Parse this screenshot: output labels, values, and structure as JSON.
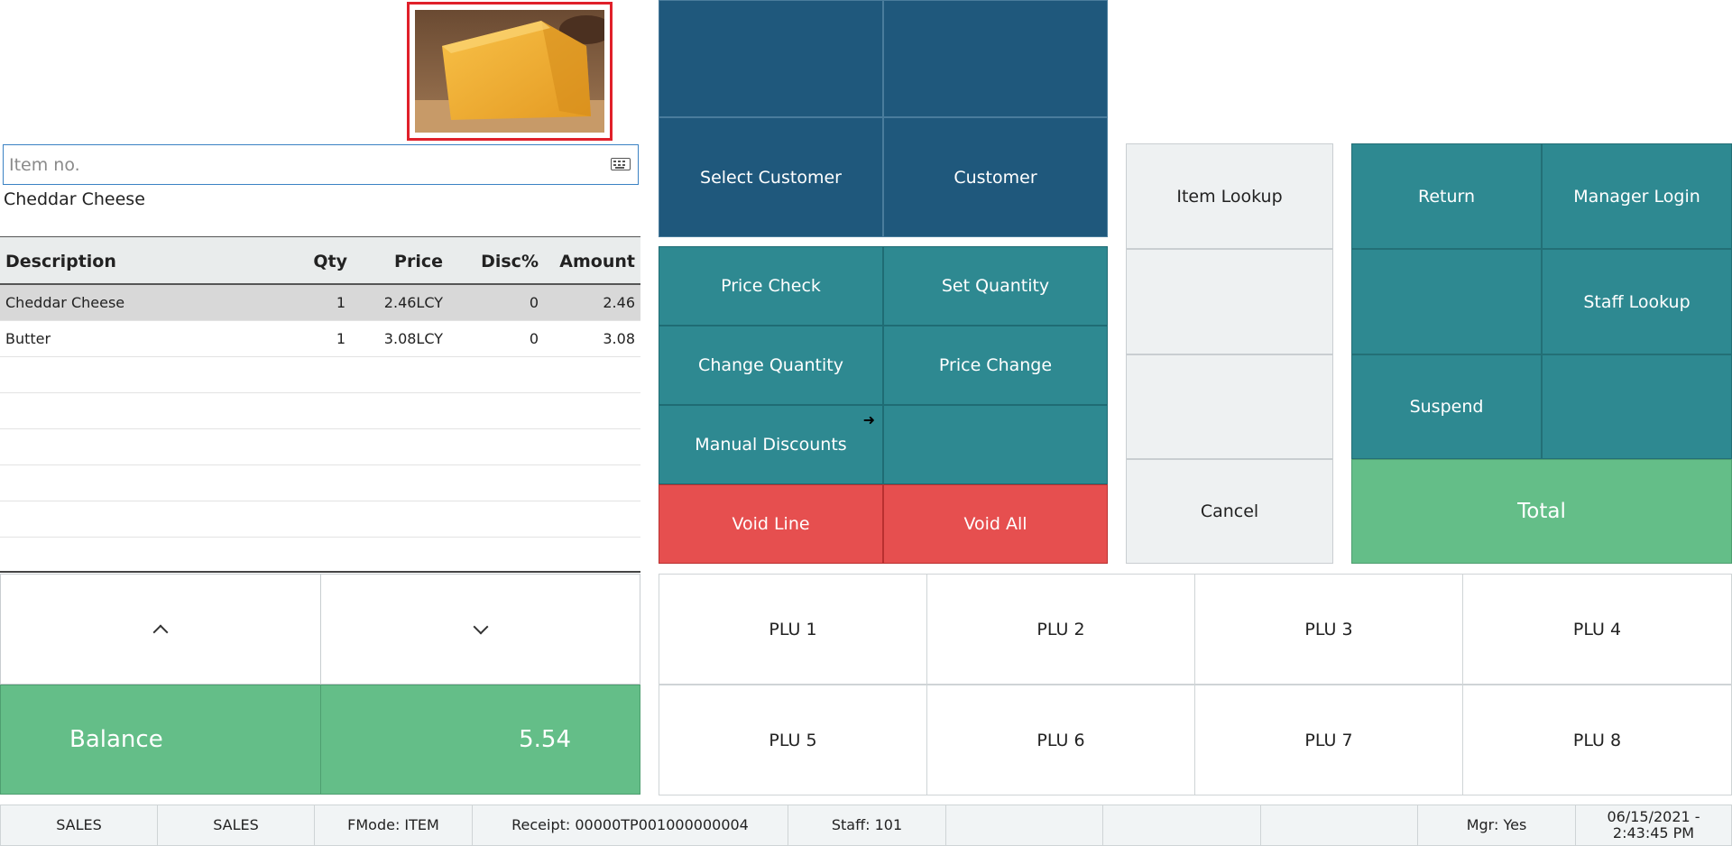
{
  "product": {
    "image_name": "cheddar-cheese-photo"
  },
  "item_entry": {
    "placeholder": "Item no.",
    "value": "",
    "last_item": "Cheddar Cheese"
  },
  "receipt": {
    "headers": {
      "description": "Description",
      "qty": "Qty",
      "price": "Price",
      "disc": "Disc%",
      "amount": "Amount"
    },
    "rows": [
      {
        "description": "Cheddar Cheese",
        "qty": "1",
        "price": "2.46LCY",
        "disc": "0",
        "amount": "2.46"
      },
      {
        "description": "Butter",
        "qty": "1",
        "price": "3.08LCY",
        "disc": "0",
        "amount": "3.08"
      }
    ]
  },
  "balance": {
    "label": "Balance",
    "value": "5.54"
  },
  "buttons": {
    "select_customer": "Select Customer",
    "customer": "Customer",
    "price_check": "Price Check",
    "set_quantity": "Set Quantity",
    "change_quantity": "Change Quantity",
    "price_change": "Price Change",
    "manual_discounts": "Manual Discounts",
    "void_line": "Void Line",
    "void_all": "Void All",
    "item_lookup": "Item Lookup",
    "cancel": "Cancel",
    "return": "Return",
    "manager_login": "Manager Login",
    "staff_lookup": "Staff Lookup",
    "suspend": "Suspend",
    "total": "Total"
  },
  "plu": [
    "PLU 1",
    "PLU 2",
    "PLU 3",
    "PLU 4",
    "PLU 5",
    "PLU 6",
    "PLU 7",
    "PLU 8"
  ],
  "status_bar": {
    "mode1": "SALES",
    "mode2": "SALES",
    "fmode": "FMode: ITEM",
    "receipt": "Receipt: 00000TP001000000004",
    "staff": "Staff: 101",
    "mgr": "Mgr: Yes",
    "datetime": "06/15/2021 - 2:43:45 PM"
  },
  "colors": {
    "dark_blue": "#1f587c",
    "teal": "#2e8991",
    "red": "#e64f4f",
    "green": "#64be88",
    "light": "#eef1f2",
    "image_border": "#e0202a"
  }
}
